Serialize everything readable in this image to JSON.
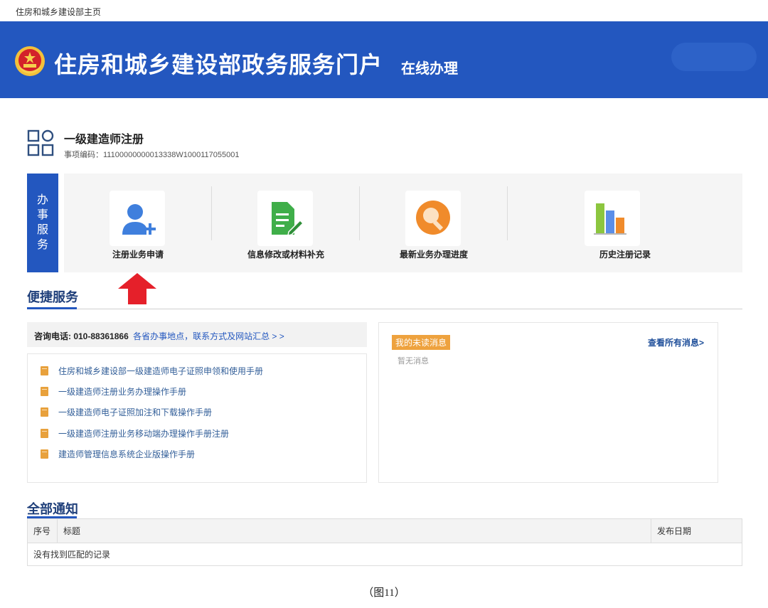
{
  "topbar": {
    "home_link": "住房和城乡建设部主页"
  },
  "banner": {
    "title": "住房和城乡建设部政务服务门户",
    "subtitle": "在线办理"
  },
  "item": {
    "title": "一级建造师注册",
    "code": "事项编码：11100000000013338W1000117055001"
  },
  "services": {
    "label_chars": [
      "办",
      "事",
      "服",
      "务"
    ],
    "items": [
      {
        "label": "注册业务申请",
        "icon": "add-user-icon"
      },
      {
        "label": "信息修改或材料补充",
        "icon": "edit-document-icon"
      },
      {
        "label": "最新业务办理进度",
        "icon": "search-icon"
      },
      {
        "label": "历史注册记录",
        "icon": "bar-chart-icon"
      }
    ]
  },
  "quick": {
    "title": "便捷服务",
    "contact_label": "咨询电话: 010-88361866",
    "contact_link": "各省办事地点，联系方式及网站汇总 > >",
    "links": [
      "住房和城乡建设部一级建造师电子证照申领和使用手册",
      "一级建造师注册业务办理操作手册",
      "一级建造师电子证照加注和下载操作手册",
      "一级建造师注册业务移动端办理操作手册注册",
      "建造师管理信息系统企业版操作手册"
    ],
    "messages": {
      "tag": "我的未读消息",
      "view_all": "查看所有消息>",
      "empty": "暂无消息"
    }
  },
  "notices": {
    "title": "全部通知",
    "columns": [
      "序号",
      "标题",
      "发布日期"
    ],
    "empty": "没有找到匹配的记录"
  },
  "caption": "（图11）",
  "colors": {
    "brand_blue": "#2357bf",
    "accent_orange": "#eea23e",
    "arrow_red": "#e5202a"
  }
}
